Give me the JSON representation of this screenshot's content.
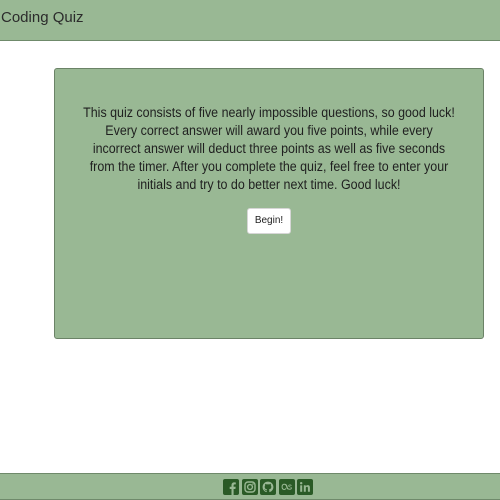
{
  "header": {
    "title": "Coding Quiz"
  },
  "quiz": {
    "intro_text": "This quiz consists of five nearly impossible questions, so good luck! Every correct answer will award you five points, while every incorrect answer will deduct three points as well as five seconds from the timer. After you complete the quiz, feel free to enter your initials and try to do better next time. Good luck!",
    "begin_label": "Begin!"
  },
  "footer": {
    "links": [
      {
        "icon": "facebook-icon"
      },
      {
        "icon": "instagram-icon"
      },
      {
        "icon": "github-icon"
      },
      {
        "icon": "lastfm-icon"
      },
      {
        "icon": "linkedin-icon"
      }
    ]
  },
  "colors": {
    "accent": "#99b894",
    "icon": "#2a5a26"
  }
}
